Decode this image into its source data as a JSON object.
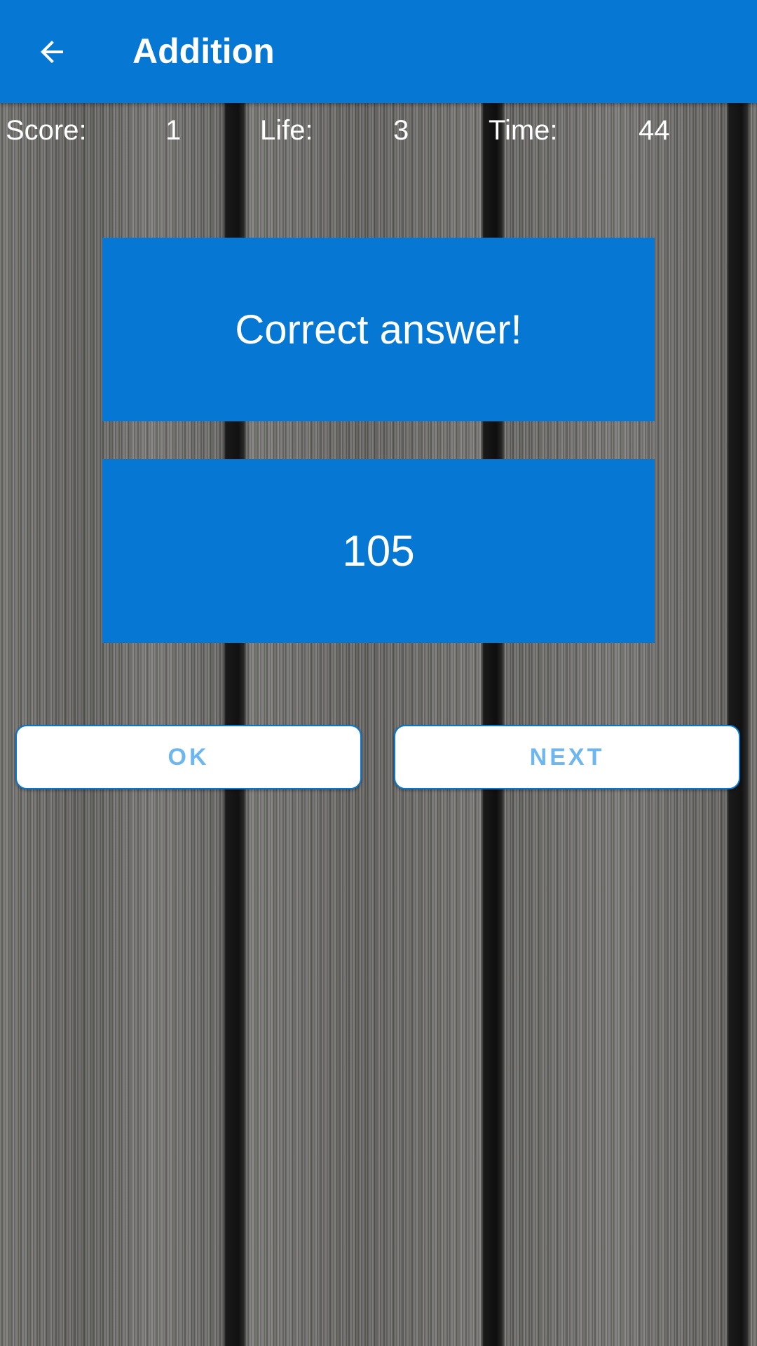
{
  "app_bar": {
    "title": "Addition",
    "back_icon": "arrow-left-icon"
  },
  "stats": {
    "score_label": "Score:",
    "score_value": "1",
    "life_label": "Life:",
    "life_value": "3",
    "time_label": "Time:",
    "time_value": "44"
  },
  "result": {
    "message": "Correct answer!",
    "answer": "105"
  },
  "buttons": {
    "ok_label": "OK",
    "next_label": "NEXT"
  },
  "colors": {
    "primary": "#0677d3",
    "button_text": "#6eb6ef",
    "background": "wood-grain"
  }
}
